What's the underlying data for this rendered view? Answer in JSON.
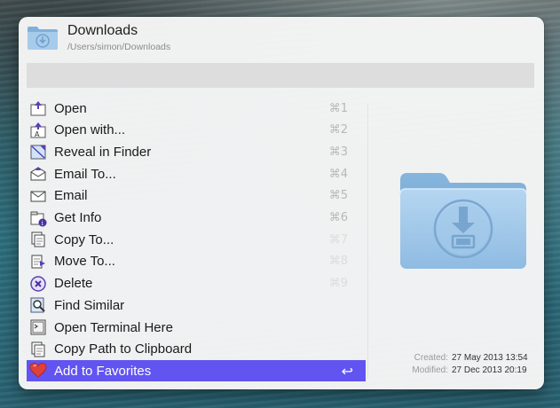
{
  "header": {
    "title": "Downloads",
    "path": "/Users/simon/Downloads"
  },
  "search": {
    "value": ""
  },
  "actions": [
    {
      "label": "Open",
      "shortcut": "⌘1",
      "icon": "open-icon"
    },
    {
      "label": "Open with...",
      "shortcut": "⌘2",
      "icon": "open-with-icon"
    },
    {
      "label": "Reveal in Finder",
      "shortcut": "⌘3",
      "icon": "reveal-icon"
    },
    {
      "label": "Email To...",
      "shortcut": "⌘4",
      "icon": "email-to-icon"
    },
    {
      "label": "Email",
      "shortcut": "⌘5",
      "icon": "email-icon"
    },
    {
      "label": "Get Info",
      "shortcut": "⌘6",
      "icon": "info-icon"
    },
    {
      "label": "Copy To...",
      "shortcut": "⌘7",
      "icon": "copy-icon"
    },
    {
      "label": "Move To...",
      "shortcut": "⌘8",
      "icon": "move-icon"
    },
    {
      "label": "Delete",
      "shortcut": "⌘9",
      "icon": "delete-icon"
    },
    {
      "label": "Find Similar",
      "shortcut": "",
      "icon": "find-similar-icon"
    },
    {
      "label": "Open Terminal Here",
      "shortcut": "",
      "icon": "terminal-icon"
    },
    {
      "label": "Copy Path to Clipboard",
      "shortcut": "",
      "icon": "copy-path-icon"
    },
    {
      "label": "Add to Favorites",
      "shortcut": "↩",
      "icon": "heart-icon",
      "selected": true
    }
  ],
  "meta": {
    "created_label": "Created:",
    "created_value": "27 May 2013 13:54",
    "modified_label": "Modified:",
    "modified_value": "27 Dec 2013 20:19"
  },
  "colors": {
    "selection": "#6254f0",
    "folder": "#9cc4e4"
  }
}
